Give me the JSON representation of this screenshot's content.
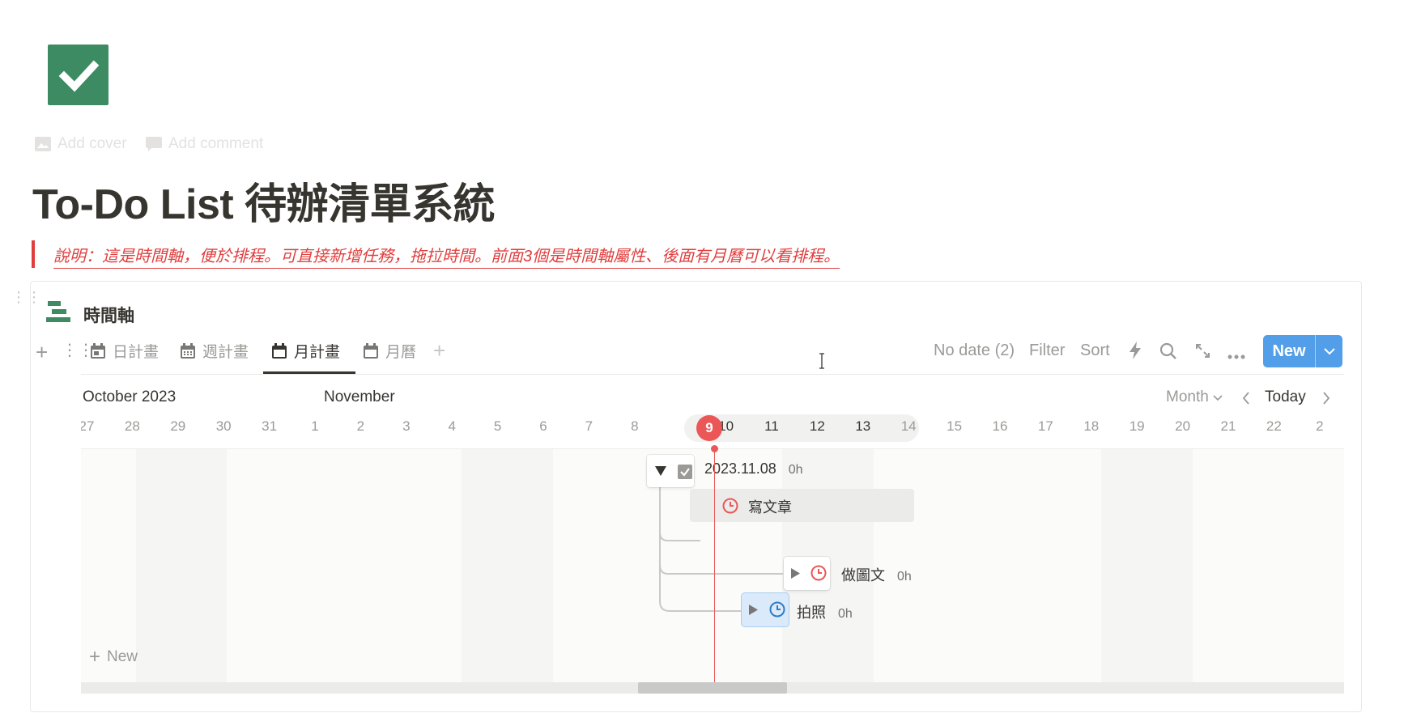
{
  "page": {
    "title": "To-Do List 待辦清單系統",
    "add_cover": "Add cover",
    "add_comment": "Add comment",
    "callout": "說明：這是時間軸，便於排程。可直接新增任務，拖拉時間。前面3個是時間軸屬性、後面有月曆可以看排程。"
  },
  "database": {
    "title": "時間軸",
    "views": [
      {
        "label": "日計畫",
        "icon": "calendar-day-icon"
      },
      {
        "label": "週計畫",
        "icon": "calendar-week-icon"
      },
      {
        "label": "月計畫",
        "icon": "calendar-icon",
        "active": true
      },
      {
        "label": "月曆",
        "icon": "calendar-icon"
      }
    ],
    "toolbar": {
      "no_date": "No date (2)",
      "filter": "Filter",
      "sort": "Sort",
      "new": "New"
    }
  },
  "timeline": {
    "month_left": "October 2023",
    "month_right": "November",
    "scale": "Month",
    "today_label": "Today",
    "today_day": "9",
    "days": [
      "27",
      "28",
      "29",
      "30",
      "31",
      "1",
      "2",
      "3",
      "4",
      "5",
      "6",
      "7",
      "8",
      "9",
      "10",
      "11",
      "12",
      "13",
      "14",
      "15",
      "16",
      "17",
      "18",
      "19",
      "20",
      "21",
      "22",
      "2"
    ],
    "items": [
      {
        "title": "2023.11.08",
        "hours": "0h"
      },
      {
        "title": "寫文章"
      },
      {
        "title": "做圖文",
        "hours": "0h"
      },
      {
        "title": "拍照",
        "hours": "0h"
      }
    ],
    "add_new": "New"
  },
  "colors": {
    "accent_red": "#eb5757",
    "callout_red": "#e03e3e",
    "new_button": "#2383e2",
    "page_icon": "#3d8b63"
  }
}
